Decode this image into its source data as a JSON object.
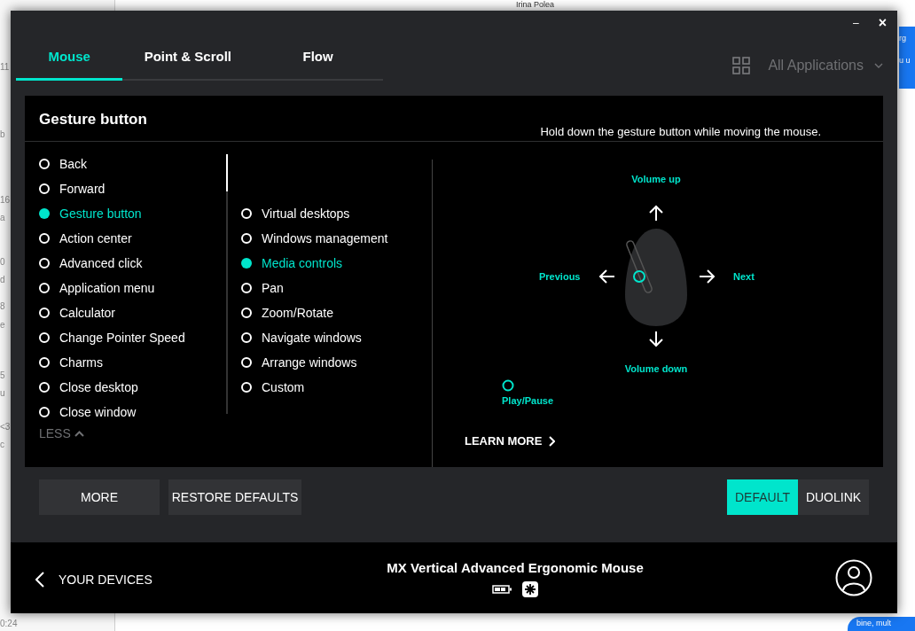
{
  "background": {
    "top_texts": [
      "Irina Polea"
    ],
    "left_texts": [
      "11",
      "b",
      "16",
      "a",
      "0",
      "d",
      "8",
      "e",
      "5",
      "u",
      "<3",
      "c",
      "0:24"
    ],
    "right_texts": [
      "rg",
      "u u"
    ],
    "bubble": "bine, mult"
  },
  "window": {
    "controls": [
      "–",
      "×"
    ]
  },
  "tabs": [
    {
      "label": "Mouse",
      "selected": true
    },
    {
      "label": "Point & Scroll",
      "selected": false
    },
    {
      "label": "Flow",
      "selected": false
    }
  ],
  "app_selector": {
    "label": "All Applications"
  },
  "panel": {
    "title": "Gesture button",
    "hint": "Hold down the gesture button while moving the mouse.",
    "actions": [
      {
        "label": "Back",
        "selected": false
      },
      {
        "label": "Forward",
        "selected": false
      },
      {
        "label": "Gesture button",
        "selected": true
      },
      {
        "label": "Action center",
        "selected": false
      },
      {
        "label": "Advanced click",
        "selected": false
      },
      {
        "label": "Application menu",
        "selected": false
      },
      {
        "label": "Calculator",
        "selected": false
      },
      {
        "label": "Change Pointer Speed",
        "selected": false
      },
      {
        "label": "Charms",
        "selected": false
      },
      {
        "label": "Close desktop",
        "selected": false
      },
      {
        "label": "Close window",
        "selected": false
      }
    ],
    "less": "LESS",
    "modes": [
      {
        "label": "Virtual desktops",
        "selected": false
      },
      {
        "label": "Windows management",
        "selected": false
      },
      {
        "label": "Media controls",
        "selected": true
      },
      {
        "label": "Pan",
        "selected": false
      },
      {
        "label": "Zoom/Rotate",
        "selected": false
      },
      {
        "label": "Navigate windows",
        "selected": false
      },
      {
        "label": "Arrange windows",
        "selected": false
      },
      {
        "label": "Custom",
        "selected": false
      }
    ],
    "gestures": {
      "up": "Volume up",
      "left": "Previous",
      "right": "Next",
      "down": "Volume down",
      "click": "Play/Pause"
    },
    "learn_more": "LEARN MORE"
  },
  "buttons": [
    "MORE",
    "RESTORE DEFAULTS"
  ],
  "profile_toggle": [
    {
      "label": "DEFAULT",
      "selected": true
    },
    {
      "label": "DUOLINK",
      "selected": false
    }
  ],
  "footer": {
    "back": "YOUR DEVICES",
    "device": "MX Vertical Advanced Ergonomic Mouse"
  }
}
